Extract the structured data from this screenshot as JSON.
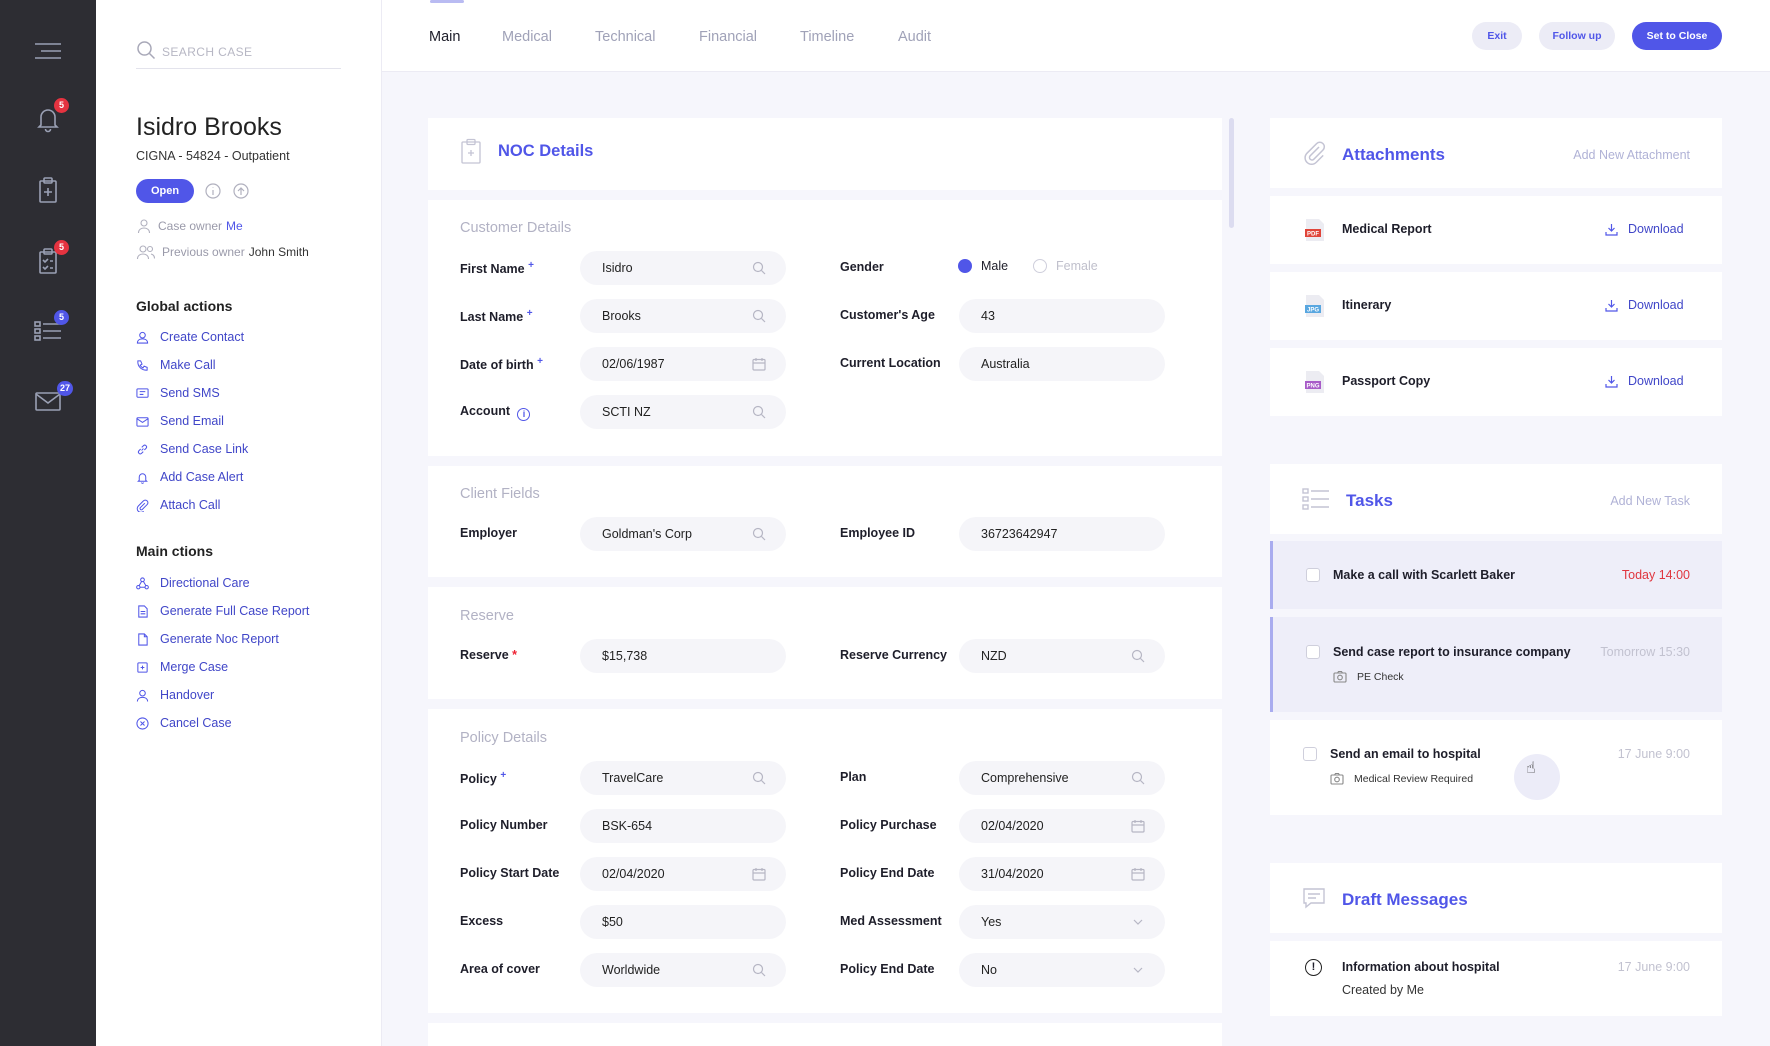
{
  "search": {
    "placeholder": "SEARCH CASE"
  },
  "rail": {
    "badges": {
      "notifications": "5",
      "checklist": "5",
      "list": "5",
      "mail": "27"
    },
    "badge_colors": {
      "red": "#e53340",
      "blue": "#5056e8"
    }
  },
  "patient": {
    "name": "Isidro Brooks",
    "subtitle": "CIGNA - 54824 - Outpatient",
    "status": "Open"
  },
  "owners": {
    "case_owner_label": "Case owner",
    "case_owner_value": "Me",
    "prev_owner_label": "Previous owner",
    "prev_owner_value": "John Smith"
  },
  "global_actions": {
    "title": "Global actions",
    "items": [
      {
        "label": "Create Contact",
        "icon": "contact-icon"
      },
      {
        "label": "Make Call",
        "icon": "phone-icon"
      },
      {
        "label": "Send SMS",
        "icon": "sms-icon"
      },
      {
        "label": "Send Email",
        "icon": "email-icon"
      },
      {
        "label": "Send Case Link",
        "icon": "link-icon"
      },
      {
        "label": "Add Case Alert",
        "icon": "bell-icon"
      },
      {
        "label": "Attach Call",
        "icon": "attach-icon"
      }
    ]
  },
  "main_actions": {
    "title": "Main ctions",
    "items": [
      {
        "label": "Directional Care",
        "icon": "network-icon"
      },
      {
        "label": "Generate Full Case Report",
        "icon": "report-icon"
      },
      {
        "label": "Generate Noc Report",
        "icon": "document-icon"
      },
      {
        "label": "Merge Case",
        "icon": "merge-icon"
      },
      {
        "label": "Handover",
        "icon": "person-icon"
      },
      {
        "label": "Cancel Case",
        "icon": "cancel-icon"
      }
    ]
  },
  "tabs": [
    "Main",
    "Medical",
    "Technical",
    "Financial",
    "Timeline",
    "Audit"
  ],
  "header_buttons": {
    "exit": "Exit",
    "follow_up": "Follow up",
    "set_to_close": "Set to Close"
  },
  "noc": {
    "title": "NOC Details",
    "customer": {
      "title": "Customer Details",
      "first_name": {
        "label": "First Name",
        "value": "Isidro"
      },
      "last_name": {
        "label": "Last Name",
        "value": "Brooks"
      },
      "dob": {
        "label": "Date of birth",
        "value": "02/06/1987"
      },
      "account": {
        "label": "Account",
        "value": "SCTI NZ"
      },
      "gender": {
        "label": "Gender",
        "male": "Male",
        "female": "Female",
        "selected": "Male"
      },
      "age": {
        "label": "Customer's Age",
        "value": "43"
      },
      "location": {
        "label": "Current Location",
        "value": "Australia"
      }
    },
    "client": {
      "title": "Client Fields",
      "employer": {
        "label": "Employer",
        "value": "Goldman's Corp"
      },
      "employee_id": {
        "label": "Employee ID",
        "value": "36723642947"
      }
    },
    "reserve": {
      "title": "Reserve",
      "reserve": {
        "label": "Reserve",
        "value": "$15,738"
      },
      "currency": {
        "label": "Reserve Currency",
        "value": "NZD"
      }
    },
    "policy": {
      "title": "Policy Details",
      "policy": {
        "label": "Policy",
        "value": "TravelCare"
      },
      "plan": {
        "label": "Plan",
        "value": "Comprehensive"
      },
      "number": {
        "label": "Policy Number",
        "value": "BSK-654"
      },
      "purchase": {
        "label": "Policy Purchase",
        "value": "02/04/2020"
      },
      "start": {
        "label": "Policy Start Date",
        "value": "02/04/2020"
      },
      "end": {
        "label": "Policy End Date",
        "value": "31/04/2020"
      },
      "excess": {
        "label": "Excess",
        "value": "$50"
      },
      "med": {
        "label": "Med Assessment",
        "value": "Yes"
      },
      "area": {
        "label": "Area of cover",
        "value": "Worldwide"
      },
      "end2": {
        "label": "Policy End Date",
        "value": "No"
      }
    }
  },
  "attachments": {
    "title": "Attachments",
    "add": "Add New Attachment",
    "download": "Download",
    "items": [
      {
        "name": "Medical Report",
        "type": "PDF",
        "color": "#e0453a"
      },
      {
        "name": "Itinerary",
        "type": "JPG",
        "color": "#59a7e0"
      },
      {
        "name": "Passport Copy",
        "type": "PNG",
        "color": "#a85cc8"
      }
    ]
  },
  "tasks": {
    "title": "Tasks",
    "add": "Add New Task",
    "items": [
      {
        "title": "Make a call with Scarlett Baker",
        "time": "Today 14:00",
        "sub": ""
      },
      {
        "title": "Send case report to insurance company",
        "time": "Tomorrow 15:30",
        "sub": "PE Check"
      },
      {
        "title": "Send an email to hospital",
        "time": "17 June 9:00",
        "sub": "Medical Review Required"
      }
    ]
  },
  "drafts": {
    "title": "Draft Messages",
    "items": [
      {
        "title": "Information about hospital",
        "sub": "Created by Me",
        "time": "17 June 9:00"
      }
    ]
  }
}
